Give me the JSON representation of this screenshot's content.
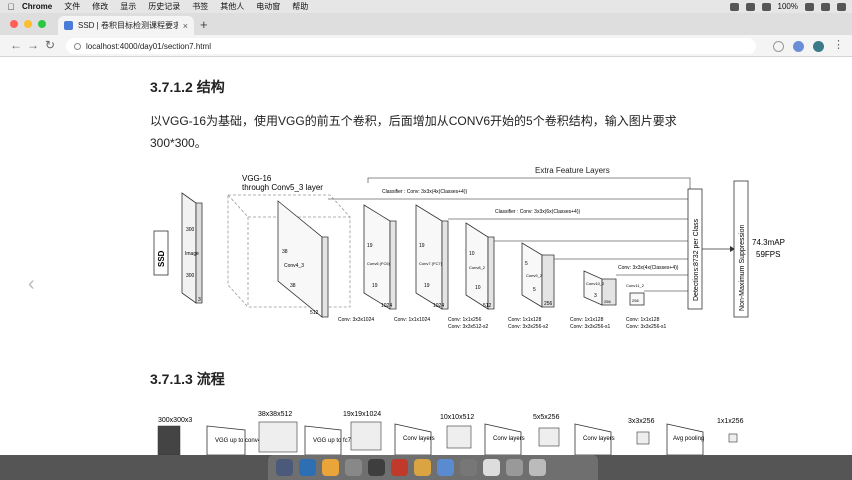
{
  "menubar": {
    "app_name": "Chrome",
    "items": [
      "文件",
      "修改",
      "显示",
      "历史记录",
      "书签",
      "其他人",
      "电动窗",
      "帮助"
    ],
    "battery": "100%",
    "right_icons": [
      "wifi-icon",
      "volume-icon",
      "bluetooth-icon",
      "battery-icon",
      "search-icon",
      "control-center-icon"
    ]
  },
  "tab": {
    "title": "SSD | 卷积目标检测课程要求",
    "close": "×",
    "new_tab": "+"
  },
  "address": {
    "url": "localhost:4000/day01/section7.html"
  },
  "doc": {
    "h_structure": "3.7.1.2 结构",
    "para_line1": "以VGG-16为基础，使用VGG的前五个卷积，后面增加从CONV6开始的5个卷积结构，输入图片要求",
    "para_line2": "300*300。",
    "h_flow": "3.7.1.3 流程"
  },
  "diagram": {
    "title_extra": "Extra Feature Layers",
    "vgg_title": "VGG-16",
    "vgg_sub": "through Conv5_3 layer",
    "ssd": "SSD",
    "image_label": "Image",
    "image_300_top": "300",
    "image_300_bottom": "300",
    "image_3": "3",
    "classifier1": "Classifier : Conv: 3x3x(4x(Classes+4))",
    "classifier2": "Classifier : Conv: 3x3x(6x(Classes+4))",
    "classifier3": "Conv: 3x3x(4x(Classes+4))",
    "conv43": "Conv4_3",
    "conv43_dims": [
      "38",
      "38",
      "512"
    ],
    "fc6": "Conv6 (FC6)",
    "fc6_dims": [
      "19",
      "19",
      "1024"
    ],
    "fc7": "Conv7 (FC7)",
    "fc7_dims": [
      "19",
      "19",
      "1024"
    ],
    "conv82": "Conv8_2",
    "conv82_dims": [
      "10",
      "10",
      "512"
    ],
    "conv92": "Conv9_2",
    "conv92_dims": [
      "5",
      "5",
      "256"
    ],
    "conv102": "Conv10_2",
    "conv102_dims": [
      "3",
      "256"
    ],
    "conv112": "Conv11_2",
    "conv112_dims": [
      "256"
    ],
    "detections": "Detections:8732 per Class",
    "nms": "Non-Maximum Suppression",
    "map": "74.3mAP",
    "fps": "59FPS",
    "conv_labels": [
      "Conv: 3x3x1024",
      "Conv: 1x1x1024",
      "Conv: 1x1x256\nConv: 3x3x512-s2",
      "Conv: 1x1x128\nConv: 3x3x256-s2",
      "Conv: 1x1x128\nConv: 3x3x256-s1",
      "Conv: 1x1x128\nConv: 3x3x256-s1"
    ]
  },
  "flow": {
    "sizes": [
      "300x300x3",
      "38x38x512",
      "19x19x1024",
      "10x10x512",
      "5x5x256",
      "3x3x256",
      "1x1x256"
    ],
    "blocks": [
      "VGG up to conv4_3",
      "VGG up to fc7",
      "Conv layers",
      "Conv layers",
      "Conv layers",
      "Avg pooling"
    ]
  },
  "colors": {
    "menubar": "#e6e6e6",
    "tabbar": "#dedede",
    "accent_blue": "#4a7bd8",
    "dock": "#555555"
  }
}
